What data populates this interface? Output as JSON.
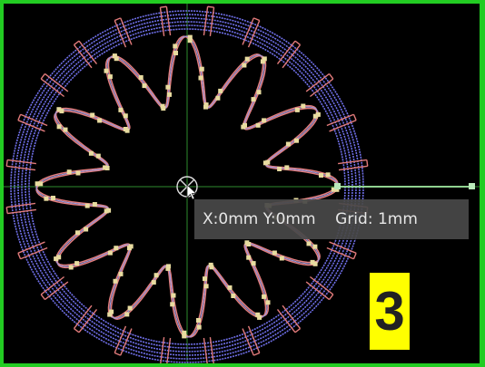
{
  "status": {
    "x_label": "X:",
    "x_value": "0mm",
    "y_label": "Y:",
    "y_value": "0mm",
    "grid_label": "Grid:",
    "grid_value": "1mm"
  },
  "badge": {
    "text": "3"
  },
  "design": {
    "outer_turns": 6,
    "spokes": 24,
    "lobes": 12,
    "colors": {
      "frame": "#22cc22",
      "background": "#000000",
      "ring": "#6f6fe8",
      "spoke": "#e07a7a",
      "trace": "#e27d7d",
      "trace_alt": "#9a9ae0",
      "via": "#e8dca0",
      "axis": "#2e8b2e",
      "highlight_track": "#8fd18f",
      "badge_bg": "#ffff00"
    },
    "cursor_icon": "crosshair-origin-icon",
    "pointer_icon": "mouse-pointer-icon"
  }
}
